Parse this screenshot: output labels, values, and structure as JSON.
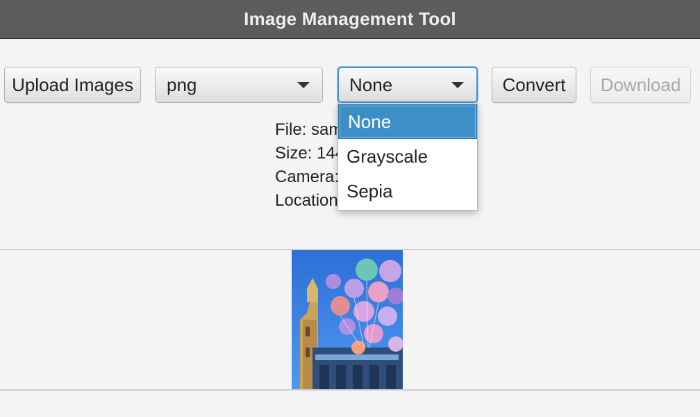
{
  "window": {
    "title": "Image Management Tool"
  },
  "toolbar": {
    "upload_label": "Upload Images",
    "format_value": "png",
    "filter_value": "None",
    "convert_label": "Convert",
    "download_label": "Download",
    "download_enabled": false
  },
  "filter_dropdown": {
    "options": [
      "None",
      "Grayscale",
      "Sepia"
    ],
    "selected": "None"
  },
  "metadata": {
    "file": "File: sam",
    "size": "Size: 144",
    "camera": "Camera:",
    "location": "Location"
  },
  "preview": {
    "icon": "image-preview"
  },
  "colors": {
    "title_bar": "#5c5c5c",
    "focus_accent": "#3e93d0",
    "selected_option": "#3f8fc7"
  }
}
